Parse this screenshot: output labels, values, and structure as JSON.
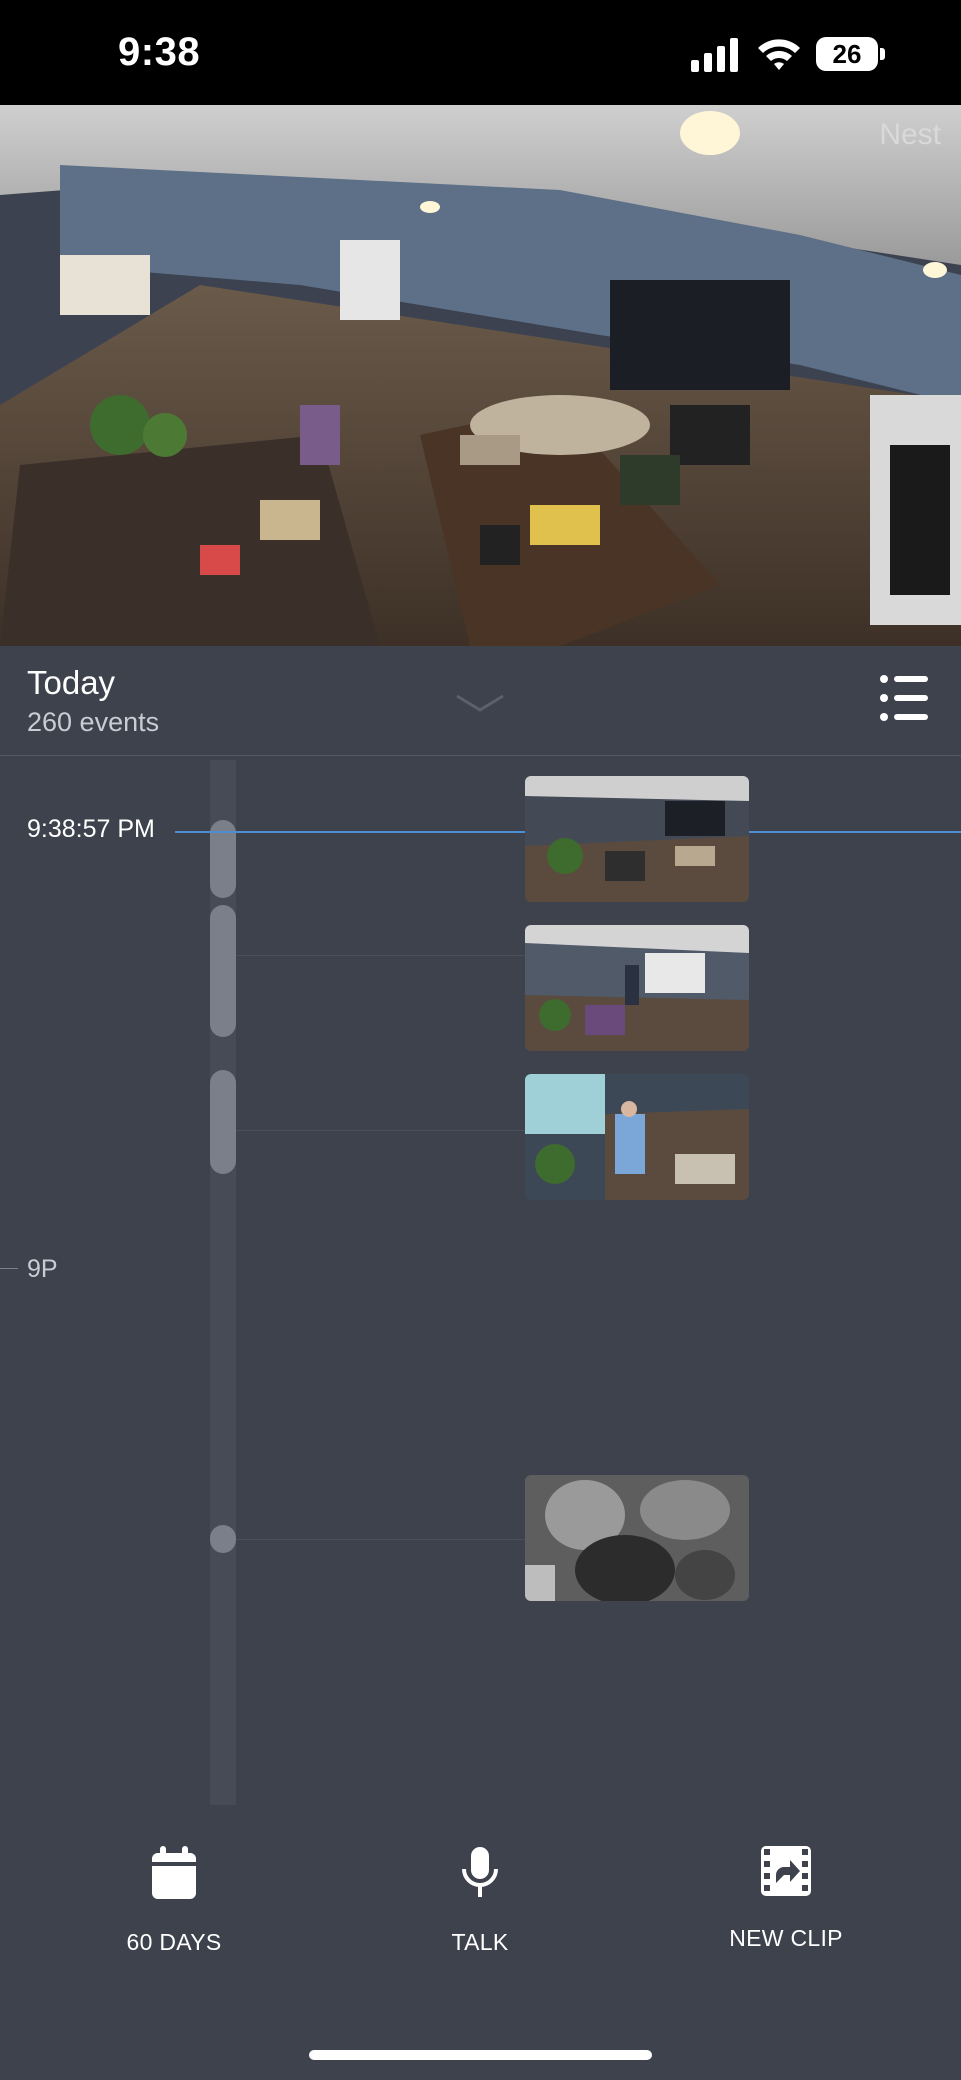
{
  "status_bar": {
    "time": "9:38",
    "battery": "26"
  },
  "camera": {
    "watermark": "Nest"
  },
  "header": {
    "title": "Today",
    "subtitle": "260 events"
  },
  "timeline": {
    "current_time": "9:38:57 PM",
    "hour_label": "9P"
  },
  "actions": [
    {
      "label": "60 DAYS",
      "icon": "calendar-icon"
    },
    {
      "label": "TALK",
      "icon": "microphone-icon"
    },
    {
      "label": "NEW CLIP",
      "icon": "clip-icon"
    }
  ]
}
